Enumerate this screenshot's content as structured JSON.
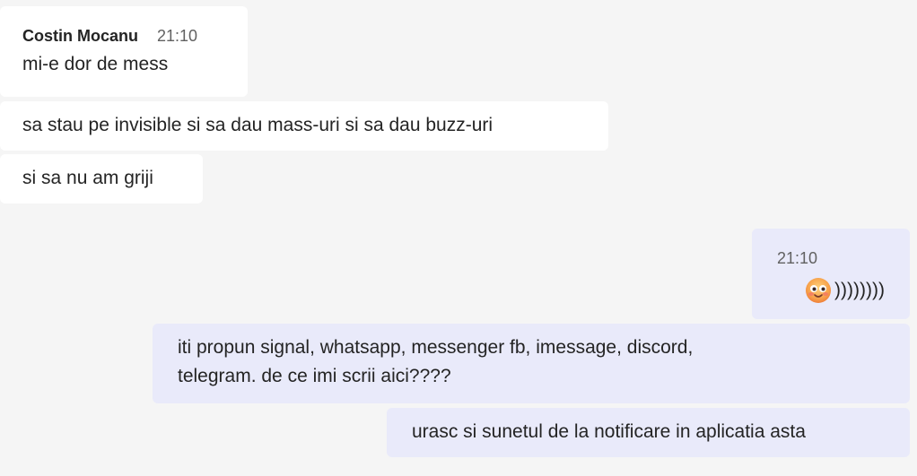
{
  "incoming": {
    "sender": "Costin Mocanu",
    "time": "21:10",
    "messages": [
      "mi-e dor de mess",
      "sa stau pe invisible si sa dau mass-uri si sa dau buzz-uri",
      "si sa nu am griji"
    ]
  },
  "outgoing": {
    "time": "21:10",
    "emoji_icon": "grinning-face-emoji",
    "emoji_suffix": "))))))))",
    "messages": [
      "iti propun signal, whatsapp, messenger fb, imessage, discord,",
      "telegram. de ce imi scrii aici????",
      "urasc si sunetul de la notificare in aplicatia asta"
    ]
  },
  "colors": {
    "background": "#f5f5f5",
    "incoming_bubble": "#ffffff",
    "outgoing_bubble": "#e9eafa",
    "text": "#242424",
    "timestamp": "#616161"
  }
}
